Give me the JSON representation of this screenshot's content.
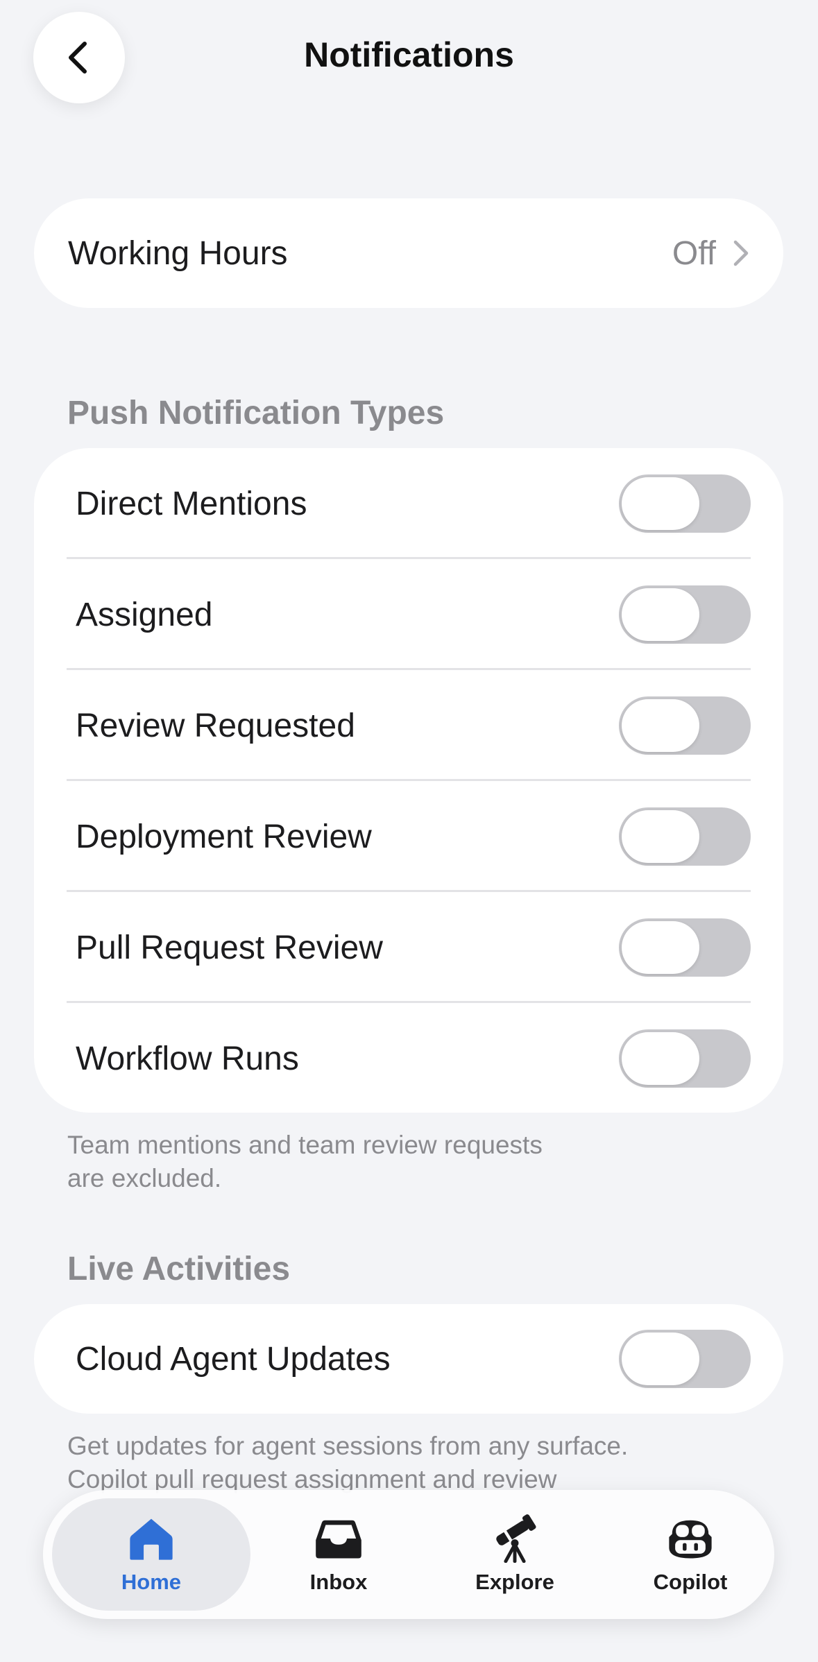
{
  "header": {
    "title": "Notifications"
  },
  "working_hours": {
    "label": "Working Hours",
    "value": "Off"
  },
  "push": {
    "header": "Push Notification Types",
    "items": [
      {
        "label": "Direct Mentions",
        "enabled": false
      },
      {
        "label": "Assigned",
        "enabled": false
      },
      {
        "label": "Review Requested",
        "enabled": false
      },
      {
        "label": "Deployment Review",
        "enabled": false
      },
      {
        "label": "Pull Request Review",
        "enabled": false
      },
      {
        "label": "Workflow Runs",
        "enabled": false
      }
    ],
    "footnote_line1": "Team mentions and team review requests",
    "footnote_line2": "are excluded."
  },
  "live": {
    "header": "Live Activities",
    "items": [
      {
        "label": "Cloud Agent Updates",
        "enabled": false
      }
    ],
    "footnote_line1": "Get updates for agent sessions from any surface.",
    "footnote_line2": "Copilot pull request assignment and review"
  },
  "tabbar": {
    "tabs": [
      {
        "label": "Home",
        "icon": "home-icon",
        "active": true
      },
      {
        "label": "Inbox",
        "icon": "inbox-icon",
        "active": false
      },
      {
        "label": "Explore",
        "icon": "telescope-icon",
        "active": false
      },
      {
        "label": "Copilot",
        "icon": "copilot-icon",
        "active": false
      }
    ]
  },
  "colors": {
    "background": "#f3f4f7",
    "card": "#ffffff",
    "toggle_off": "#c8c8cc",
    "secondary_text": "#8a8a8e",
    "accent": "#2f6fd6"
  }
}
